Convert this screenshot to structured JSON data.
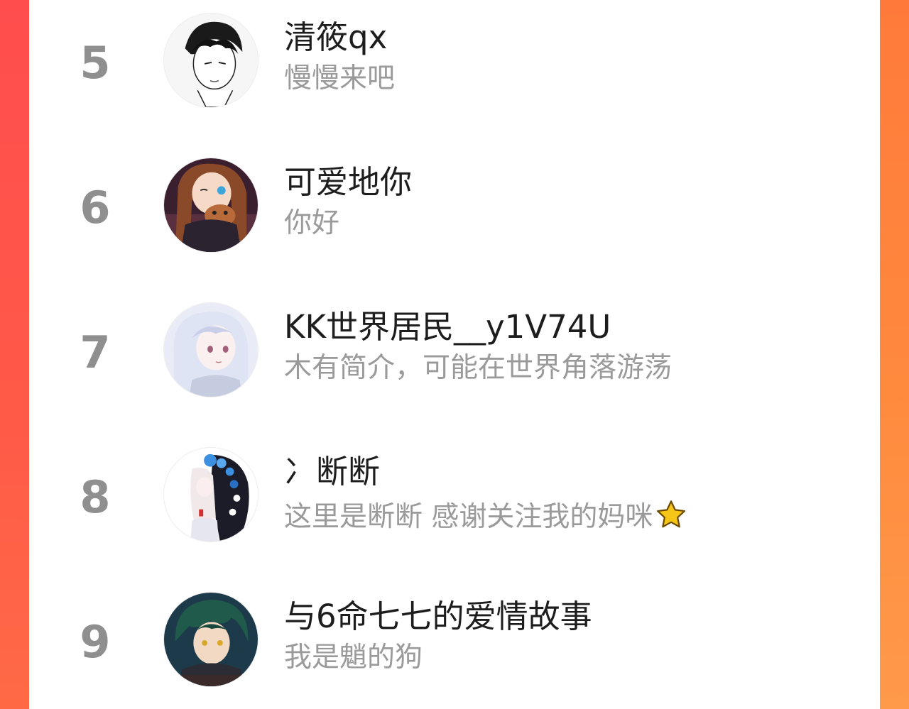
{
  "rows": [
    {
      "rank": "5",
      "name": "清筱qx",
      "bio": "慢慢来吧",
      "avatar_icon": "anime-boy-sketch-avatar"
    },
    {
      "rank": "6",
      "name": "可爱地你",
      "bio": "你好",
      "avatar_icon": "anime-girl-winking-avatar"
    },
    {
      "rank": "7",
      "name": "KK世界居民__y1V74U",
      "bio": "木有简介，可能在世界角落游荡",
      "avatar_icon": "anime-white-hair-girl-avatar"
    },
    {
      "rank": "8",
      "name": "冫断断",
      "bio": "这里是断断 感谢关注我的妈咪",
      "avatar_icon": "anime-blue-flower-girl-avatar",
      "bio_emoji": "star-icon"
    },
    {
      "rank": "9",
      "name": "与6命七七的爱情故事",
      "bio": "我是魈的狗",
      "avatar_icon": "anime-green-hair-boy-avatar"
    }
  ],
  "colors": {
    "accent_left": "#ff5a48",
    "accent_right": "#ff8a3e",
    "rank_text": "#8f8f8f",
    "name_text": "#1d1d1d",
    "bio_text": "#9a9a9a",
    "star": "#f5c518"
  }
}
